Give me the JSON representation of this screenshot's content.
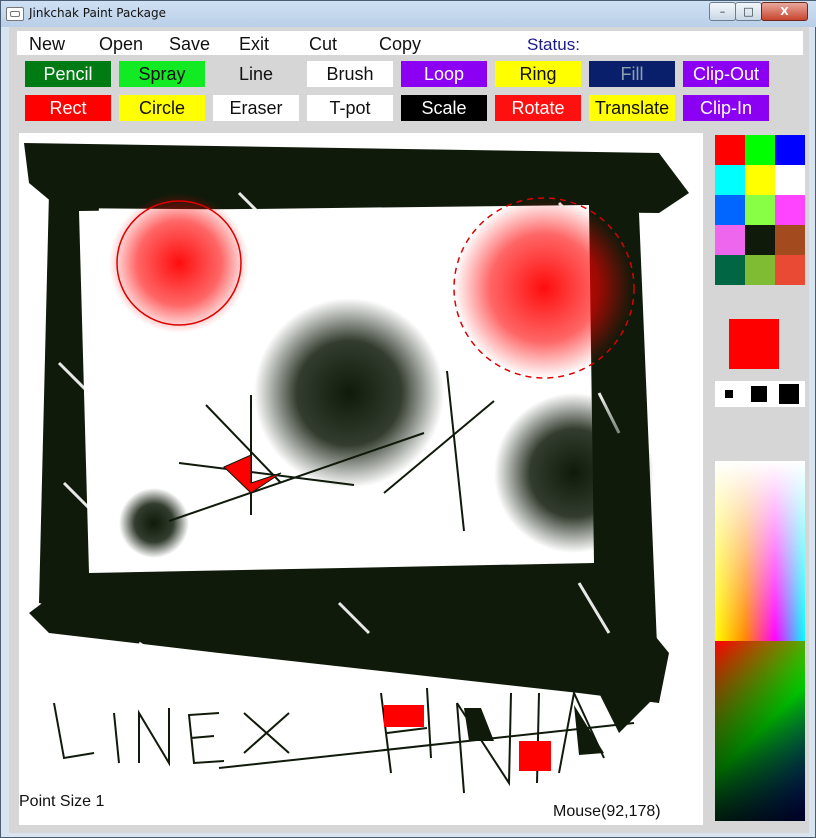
{
  "window": {
    "title": "Jinkchak Paint Package",
    "min_label": "–",
    "max_label": "□",
    "close_label": "X"
  },
  "menu": {
    "items": [
      "New",
      "Open",
      "Save",
      "Exit",
      "Cut",
      "Copy"
    ],
    "status_label": "Status:"
  },
  "tools": {
    "row1": [
      {
        "label": "Pencil",
        "bg": "#007a12",
        "fg": "#ffffff"
      },
      {
        "label": "Spray",
        "bg": "#12ea24",
        "fg": "#111111"
      },
      {
        "label": "Line",
        "bg": "#d6d6d6",
        "fg": "#111111"
      },
      {
        "label": "Brush",
        "bg": "#ffffff",
        "fg": "#111111"
      },
      {
        "label": "Loop",
        "bg": "#8b00f2",
        "fg": "#ffffff"
      },
      {
        "label": "Ring",
        "bg": "#ffff00",
        "fg": "#111111"
      },
      {
        "label": "Fill",
        "bg": "#0a1f6b",
        "fg": "#8da0ad"
      },
      {
        "label": "Clip-Out",
        "bg": "#8b00f2",
        "fg": "#ffffff"
      }
    ],
    "row2": [
      {
        "label": "Rect",
        "bg": "#ff0000",
        "fg": "#ffffff"
      },
      {
        "label": "Circle",
        "bg": "#ffff00",
        "fg": "#111111"
      },
      {
        "label": "Eraser",
        "bg": "#ffffff",
        "fg": "#111111"
      },
      {
        "label": "T-pot",
        "bg": "#ffffff",
        "fg": "#111111"
      },
      {
        "label": "Scale",
        "bg": "#000000",
        "fg": "#ffffff"
      },
      {
        "label": "Rotate",
        "bg": "#ff1010",
        "fg": "#ffffff"
      },
      {
        "label": "Translate",
        "bg": "#ffff00",
        "fg": "#111111"
      },
      {
        "label": "Clip-In",
        "bg": "#8b00f2",
        "fg": "#ffffff"
      }
    ]
  },
  "canvas": {
    "drawing_text": "LINEX HINTA",
    "point_size_text": "Point Size 1",
    "mouse_text": "Mouse(92,178)"
  },
  "palette": {
    "swatches": [
      "#ff0000",
      "#00ff00",
      "#0000ff",
      "#00ffff",
      "#ffff00",
      "#ffffff",
      "#0066ff",
      "#88ff44",
      "#ff44ff",
      "#ee66ee",
      "#0f1a0a",
      "#a34a1e",
      "#006644",
      "#7fbb33",
      "#e84a33"
    ],
    "current_color": "#ff0000",
    "point_sizes": [
      1,
      2,
      3
    ]
  }
}
